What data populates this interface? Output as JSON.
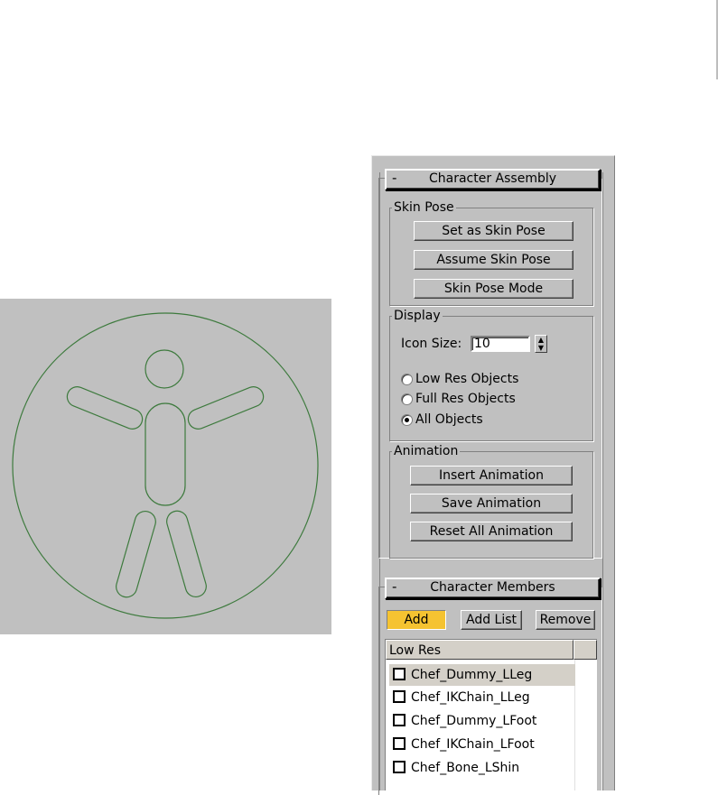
{
  "character_assembly": {
    "collapse_symbol": "-",
    "title": "Character Assembly",
    "skin_pose": {
      "legend": "Skin Pose",
      "buttons": [
        "Set as Skin Pose",
        "Assume Skin Pose",
        "Skin Pose Mode"
      ]
    },
    "display": {
      "legend": "Display",
      "icon_size_label": "Icon Size:",
      "icon_size_value": "10",
      "radios": [
        {
          "label": "Low Res Objects",
          "checked": false
        },
        {
          "label": "Full Res Objects",
          "checked": false
        },
        {
          "label": "All Objects",
          "checked": true
        }
      ]
    },
    "animation": {
      "legend": "Animation",
      "buttons": [
        "Insert Animation",
        "Save Animation",
        "Reset All Animation"
      ]
    }
  },
  "character_members": {
    "collapse_symbol": "-",
    "title": "Character Members",
    "add_label": "Add",
    "add_list_label": "Add List",
    "remove_label": "Remove",
    "list_header": "Low Res",
    "items": [
      "Chef_Dummy_LLeg",
      "Chef_IKChain_LLeg",
      "Chef_Dummy_LFoot",
      "Chef_IKChain_LFoot",
      "Chef_Bone_LShin"
    ]
  },
  "colors": {
    "viewport_bg": "#c0c0c0",
    "icon_stroke": "#3d7a3d",
    "active_button": "#f5c331"
  },
  "icons": {
    "viewport": "character-assembly-icon"
  }
}
